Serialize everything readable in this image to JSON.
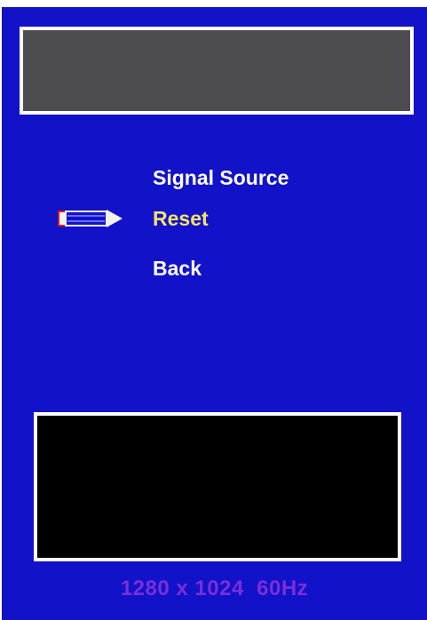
{
  "osd": {
    "menu": [
      {
        "label": "Signal Source",
        "selected": false
      },
      {
        "label": "Reset",
        "selected": true
      },
      {
        "label": "Back",
        "selected": false
      }
    ],
    "pointer_icon": "pencil-pointer-icon",
    "status_text": "1280 x 1024  60Hz"
  },
  "colors": {
    "background": "#1212c8",
    "title_box": "#4d4d4f",
    "preview_box": "#000000",
    "menu_text": "#ffffff",
    "selected_text": "#f4e46a",
    "status_text": "#7b2ed8"
  }
}
